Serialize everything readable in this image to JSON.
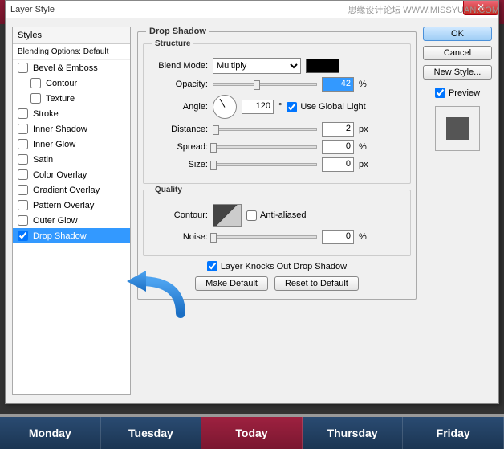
{
  "watermark": {
    "cn": "思缘设计论坛",
    "url": "WWW.MISSYUAN.COM"
  },
  "bg_day": "Tuesday",
  "dialog": {
    "title": "Layer Style",
    "styles_header": "Styles",
    "blend_opts": "Blending Options: Default",
    "items": [
      {
        "label": "Bevel & Emboss",
        "checked": false,
        "indent": false
      },
      {
        "label": "Contour",
        "checked": false,
        "indent": true
      },
      {
        "label": "Texture",
        "checked": false,
        "indent": true
      },
      {
        "label": "Stroke",
        "checked": false,
        "indent": false
      },
      {
        "label": "Inner Shadow",
        "checked": false,
        "indent": false
      },
      {
        "label": "Inner Glow",
        "checked": false,
        "indent": false
      },
      {
        "label": "Satin",
        "checked": false,
        "indent": false
      },
      {
        "label": "Color Overlay",
        "checked": false,
        "indent": false
      },
      {
        "label": "Gradient Overlay",
        "checked": false,
        "indent": false
      },
      {
        "label": "Pattern Overlay",
        "checked": false,
        "indent": false
      },
      {
        "label": "Outer Glow",
        "checked": false,
        "indent": false
      },
      {
        "label": "Drop Shadow",
        "checked": true,
        "indent": false,
        "selected": true
      }
    ],
    "drop_shadow": {
      "legend": "Drop Shadow",
      "structure_legend": "Structure",
      "blend_mode_label": "Blend Mode:",
      "blend_mode_value": "Multiply",
      "opacity_label": "Opacity:",
      "opacity_value": "42",
      "opacity_unit": "%",
      "angle_label": "Angle:",
      "angle_value": "120",
      "angle_unit": "°",
      "global_light_label": "Use Global Light",
      "global_light_checked": true,
      "distance_label": "Distance:",
      "distance_value": "2",
      "distance_unit": "px",
      "spread_label": "Spread:",
      "spread_value": "0",
      "spread_unit": "%",
      "size_label": "Size:",
      "size_value": "0",
      "size_unit": "px",
      "quality_legend": "Quality",
      "contour_label": "Contour:",
      "anti_aliased_label": "Anti-aliased",
      "anti_aliased_checked": false,
      "noise_label": "Noise:",
      "noise_value": "0",
      "noise_unit": "%",
      "knocks_out_label": "Layer Knocks Out Drop Shadow",
      "knocks_out_checked": true,
      "make_default": "Make Default",
      "reset_default": "Reset to Default"
    },
    "buttons": {
      "ok": "OK",
      "cancel": "Cancel",
      "new_style": "New Style...",
      "preview": "Preview",
      "preview_checked": true
    }
  },
  "tabs": [
    "Monday",
    "Tuesday",
    "Today",
    "Thursday",
    "Friday"
  ]
}
